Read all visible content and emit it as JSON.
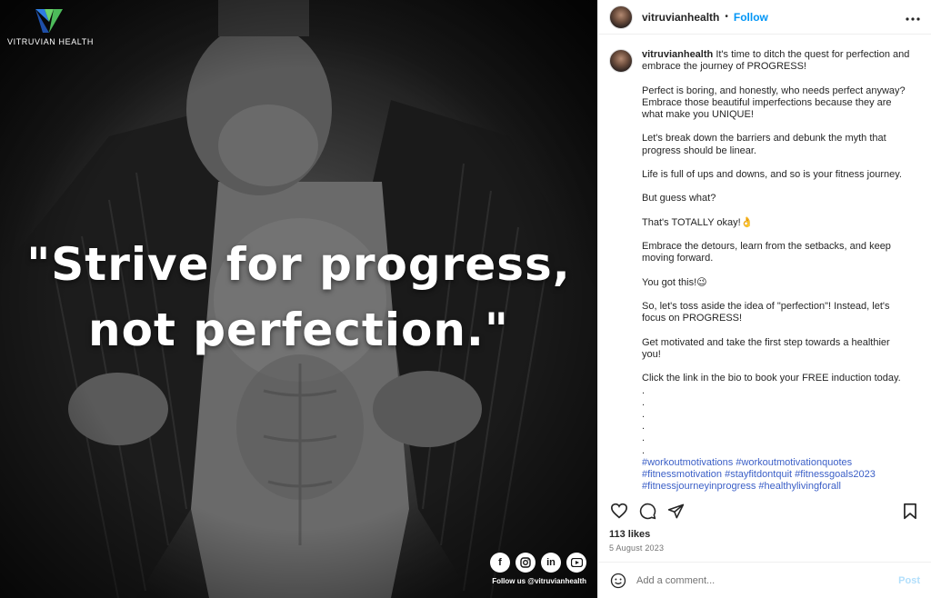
{
  "image": {
    "brand_name": "VITRUVIAN HEALTH",
    "quote_line1": "\"Strive for progress,",
    "quote_line2": "not perfection.\"",
    "social_icons": [
      "facebook-icon",
      "instagram-icon",
      "linkedin-icon",
      "youtube-icon"
    ],
    "social_text": "Follow us @vitruvianhealth"
  },
  "header": {
    "username": "vitruvianhealth",
    "separator": "•",
    "follow_label": "Follow",
    "more_icon": "more-options-icon"
  },
  "caption": {
    "username": "vitruvianhealth",
    "paragraphs": [
      "It's time to ditch the quest for perfection and embrace the journey of PROGRESS!",
      "Perfect is boring, and honestly, who needs perfect anyway? Embrace those beautiful imperfections because they are what make you UNIQUE!",
      "Let's break down the barriers and debunk the myth that progress should be linear.",
      "Life is full of ups and downs, and so is your fitness journey.",
      "But guess what?",
      "That's TOTALLY okay!👌",
      "Embrace the detours, learn from the setbacks, and keep moving forward.",
      "You got this!😉",
      "So, let's toss aside the idea of \"perfection\"! Instead, let's focus on PROGRESS!",
      "Get motivated and take the first step towards a healthier you!",
      "Click the link in the bio to book your FREE induction today."
    ],
    "dots": [
      ".",
      ".",
      ".",
      ".",
      ".",
      "."
    ],
    "hashtags": "#workoutmotivations #workoutmotivationquotes #fitnessmotivation #stayfitdontquit #fitnessgoals2023 #fitnessjourneyinprogress #healthylivingforall #healthylifestylechoices #fitnessaustralia #melbournefitness"
  },
  "actions": {
    "like_icon": "heart-icon",
    "comment_icon": "comment-icon",
    "share_icon": "share-icon",
    "save_icon": "bookmark-icon"
  },
  "likes": "113 likes",
  "date": "5 August 2023",
  "comment_box": {
    "placeholder": "Add a comment...",
    "post_label": "Post",
    "emoji_icon": "emoji-icon"
  },
  "colors": {
    "follow": "#0095f6",
    "hashtag": "#3b5fc7",
    "post_disabled": "#b2dffc"
  }
}
